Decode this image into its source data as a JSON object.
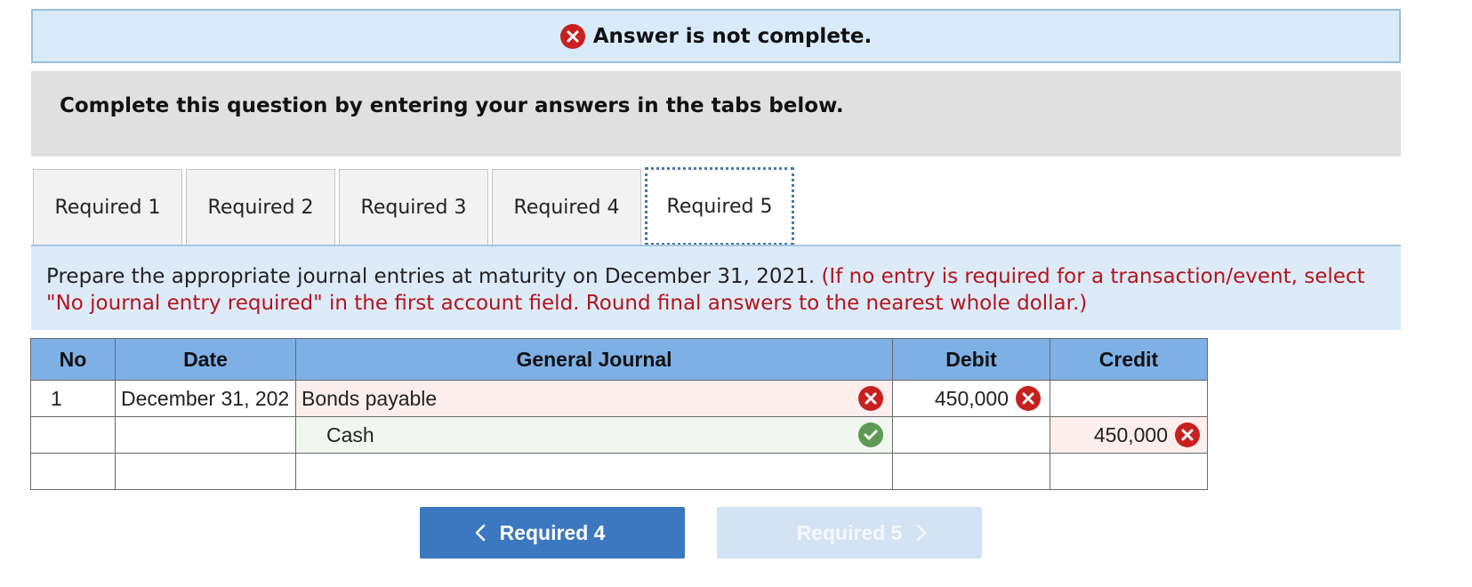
{
  "banner": {
    "status_text": "Answer is not complete.",
    "icon": "error-x-icon",
    "color": "#c8201f"
  },
  "instructions": "Complete this question by entering your answers in the tabs below.",
  "tabs": [
    {
      "label": "Required 1",
      "active": false
    },
    {
      "label": "Required 2",
      "active": false
    },
    {
      "label": "Required 3",
      "active": false
    },
    {
      "label": "Required 4",
      "active": false
    },
    {
      "label": "Required 5",
      "active": true
    }
  ],
  "prompt": {
    "text": "Prepare the appropriate journal entries at maturity on December 31, 2021.",
    "note": "(If no entry is required for a transaction/event, select \"No journal entry required\" in the first account field. Round final answers to the nearest whole dollar.)"
  },
  "journal": {
    "headers": {
      "no": "No",
      "date": "Date",
      "account": "General Journal",
      "debit": "Debit",
      "credit": "Credit"
    },
    "rows": [
      {
        "no": "1",
        "date": "December 31, 202",
        "account": "Bonds payable",
        "account_status": "incorrect",
        "debit": "450,000",
        "debit_status": "incorrect",
        "credit": "",
        "credit_status": ""
      },
      {
        "no": "",
        "date": "",
        "account": "Cash",
        "account_status": "correct",
        "debit": "",
        "debit_status": "",
        "credit": "450,000",
        "credit_status": "incorrect"
      },
      {
        "no": "",
        "date": "",
        "account": "",
        "account_status": "",
        "debit": "",
        "debit_status": "",
        "credit": "",
        "credit_status": ""
      }
    ]
  },
  "navigation": {
    "prev_label": "Required 4",
    "next_label": "Required 5",
    "next_enabled": false
  },
  "colors": {
    "error": "#c8201f",
    "correct": "#5e9a54",
    "header_blue": "#7eb0e6",
    "button_blue": "#3c78bf"
  }
}
